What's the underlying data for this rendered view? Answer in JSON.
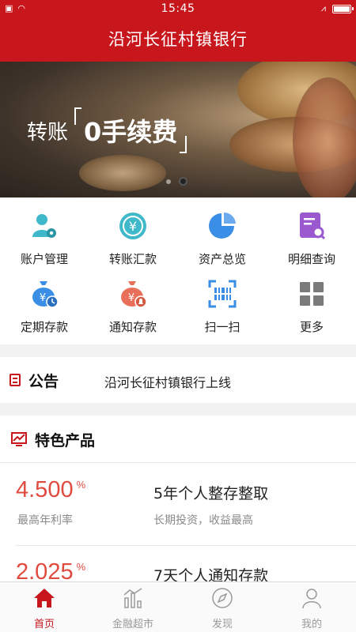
{
  "status_bar": {
    "time": "15:45"
  },
  "header": {
    "title": "沿河长征村镇银行"
  },
  "banner": {
    "text_prefix": "转账",
    "text_main": "0手续费",
    "slide_count": 2,
    "active_slide": 2
  },
  "quick_actions": [
    {
      "label": "账户管理",
      "icon": "account-manage-icon",
      "color": "#3fb9c9"
    },
    {
      "label": "转账汇款",
      "icon": "transfer-yuan-icon",
      "color": "#3fb9c9"
    },
    {
      "label": "资产总览",
      "icon": "pie-chart-icon",
      "color": "#3a8ee6"
    },
    {
      "label": "明细查询",
      "icon": "document-search-icon",
      "color": "#9b59d0"
    },
    {
      "label": "定期存款",
      "icon": "money-bag-clock-icon",
      "color": "#3a8ee6"
    },
    {
      "label": "通知存款",
      "icon": "money-bag-bell-icon",
      "color": "#e8705a"
    },
    {
      "label": "扫一扫",
      "icon": "scan-icon",
      "color": "#3a8ee6"
    },
    {
      "label": "更多",
      "icon": "more-grid-icon",
      "color": "#7a7a7a"
    }
  ],
  "notice": {
    "title": "公告",
    "text": "沿河长征村镇银行上线"
  },
  "products": {
    "title": "特色产品",
    "items": [
      {
        "rate": "4.500",
        "unit": "%",
        "rate_label": "最高年利率",
        "name": "5年个人整存整取",
        "desc": "长期投资，收益最高"
      },
      {
        "rate": "2.025",
        "unit": "%",
        "rate_label": "",
        "name": "7天个人通知存款",
        "desc": ""
      }
    ]
  },
  "tabbar": [
    {
      "label": "首页",
      "icon": "home-icon",
      "active": true
    },
    {
      "label": "金融超市",
      "icon": "bar-chart-icon",
      "active": false
    },
    {
      "label": "发现",
      "icon": "compass-icon",
      "active": false
    },
    {
      "label": "我的",
      "icon": "user-icon",
      "active": false
    }
  ],
  "colors": {
    "brand": "#c8161d",
    "rate": "#e04a3f"
  }
}
